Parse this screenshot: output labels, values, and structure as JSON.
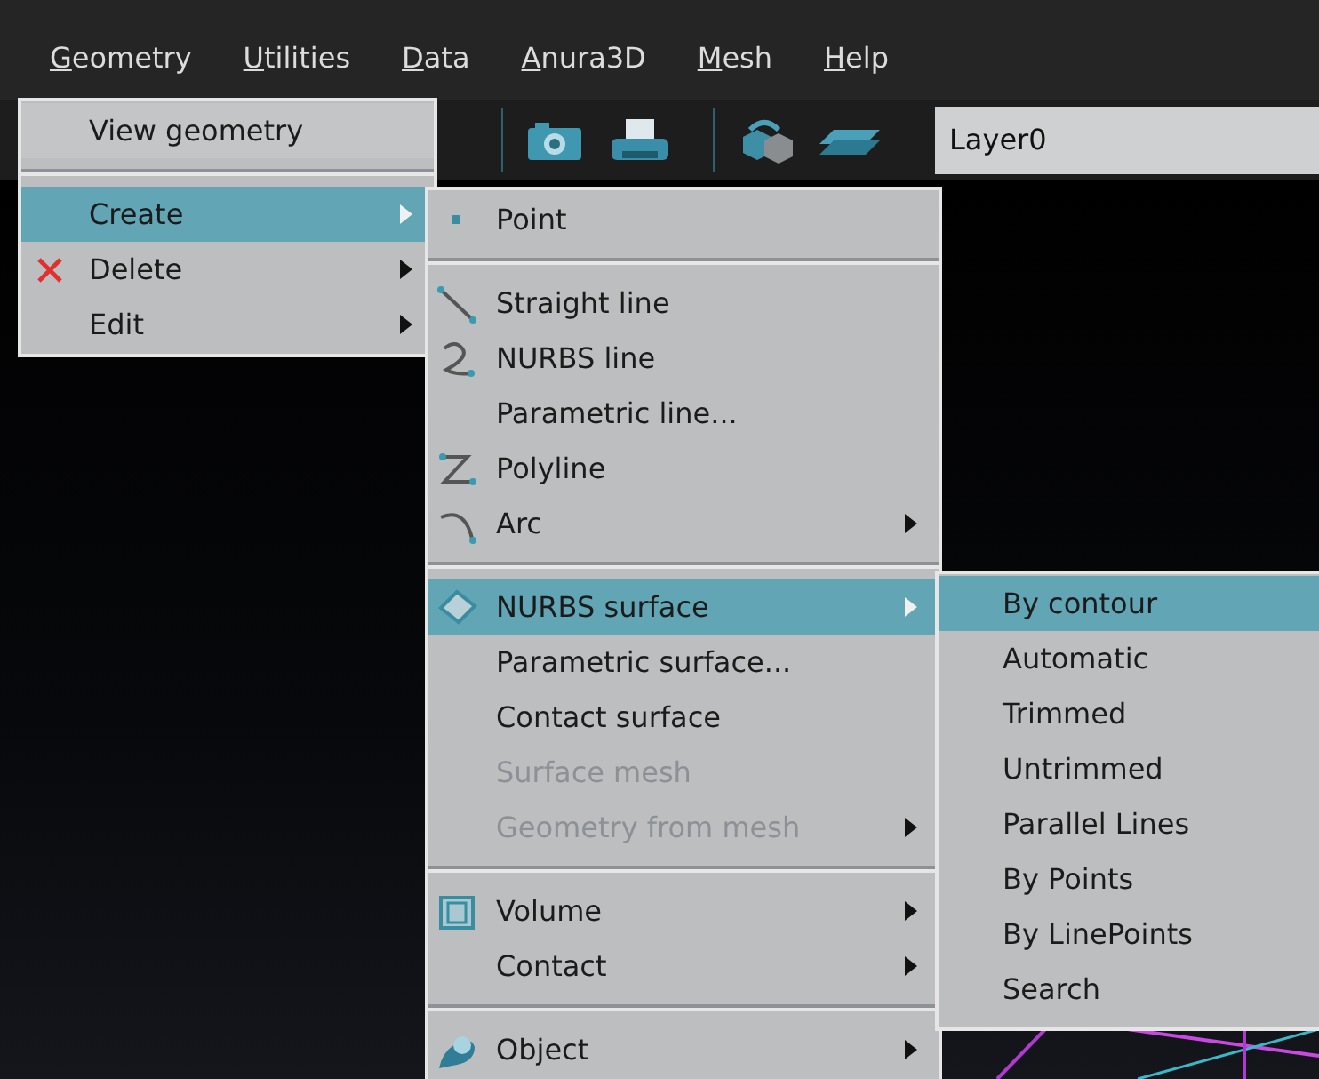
{
  "menubar": [
    {
      "label": "Geometry",
      "mnemonic": true
    },
    {
      "label": "Utilities",
      "mnemonic": true
    },
    {
      "label": "Data",
      "mnemonic": true
    },
    {
      "label": "Anura3D",
      "mnemonic": true
    },
    {
      "label": "Mesh",
      "mnemonic": true
    },
    {
      "label": "Help",
      "mnemonic": true
    }
  ],
  "toolbar": {
    "layer_field": {
      "value": "Layer0"
    }
  },
  "menus": [
    {
      "items": [
        {
          "label": "View geometry",
          "selected": false,
          "submenu": false
        },
        {
          "kind": "separator"
        },
        {
          "label": "Create",
          "selected": true,
          "submenu": true
        },
        {
          "label": "Delete",
          "selected": false,
          "submenu": true
        },
        {
          "label": "Edit",
          "selected": false,
          "submenu": true
        }
      ]
    },
    {
      "items": [
        {
          "label": "Point",
          "selected": false,
          "submenu": false
        },
        {
          "kind": "separator"
        },
        {
          "label": "Straight line",
          "selected": false,
          "submenu": false
        },
        {
          "label": "NURBS line",
          "selected": false,
          "submenu": false
        },
        {
          "label": "Parametric line...",
          "selected": false,
          "submenu": false
        },
        {
          "label": "Polyline",
          "selected": false,
          "submenu": false
        },
        {
          "label": "Arc",
          "selected": false,
          "submenu": true
        },
        {
          "kind": "separator"
        },
        {
          "label": "NURBS surface",
          "selected": true,
          "submenu": true
        },
        {
          "label": "Parametric surface...",
          "selected": false,
          "submenu": false
        },
        {
          "label": "Contact surface",
          "selected": false,
          "submenu": false
        },
        {
          "label": "Surface mesh",
          "selected": false,
          "submenu": false,
          "disabled": true
        },
        {
          "label": "Geometry from mesh",
          "selected": false,
          "submenu": true,
          "disabled": true
        },
        {
          "kind": "separator"
        },
        {
          "label": "Volume",
          "selected": false,
          "submenu": true
        },
        {
          "label": "Contact",
          "selected": false,
          "submenu": true
        },
        {
          "kind": "separator"
        },
        {
          "label": "Object",
          "selected": false,
          "submenu": true
        }
      ]
    },
    {
      "items": [
        {
          "label": "By contour",
          "selected": true,
          "submenu": false
        },
        {
          "label": "Automatic",
          "selected": false,
          "submenu": false
        },
        {
          "label": "Trimmed",
          "selected": false,
          "submenu": false
        },
        {
          "label": "Untrimmed",
          "selected": false,
          "submenu": false
        },
        {
          "label": "Parallel Lines",
          "selected": false,
          "submenu": false
        },
        {
          "label": "By Points",
          "selected": false,
          "submenu": false
        },
        {
          "label": "By LinePoints",
          "selected": false,
          "submenu": false
        },
        {
          "label": "Search",
          "selected": false,
          "submenu": false
        }
      ]
    }
  ]
}
